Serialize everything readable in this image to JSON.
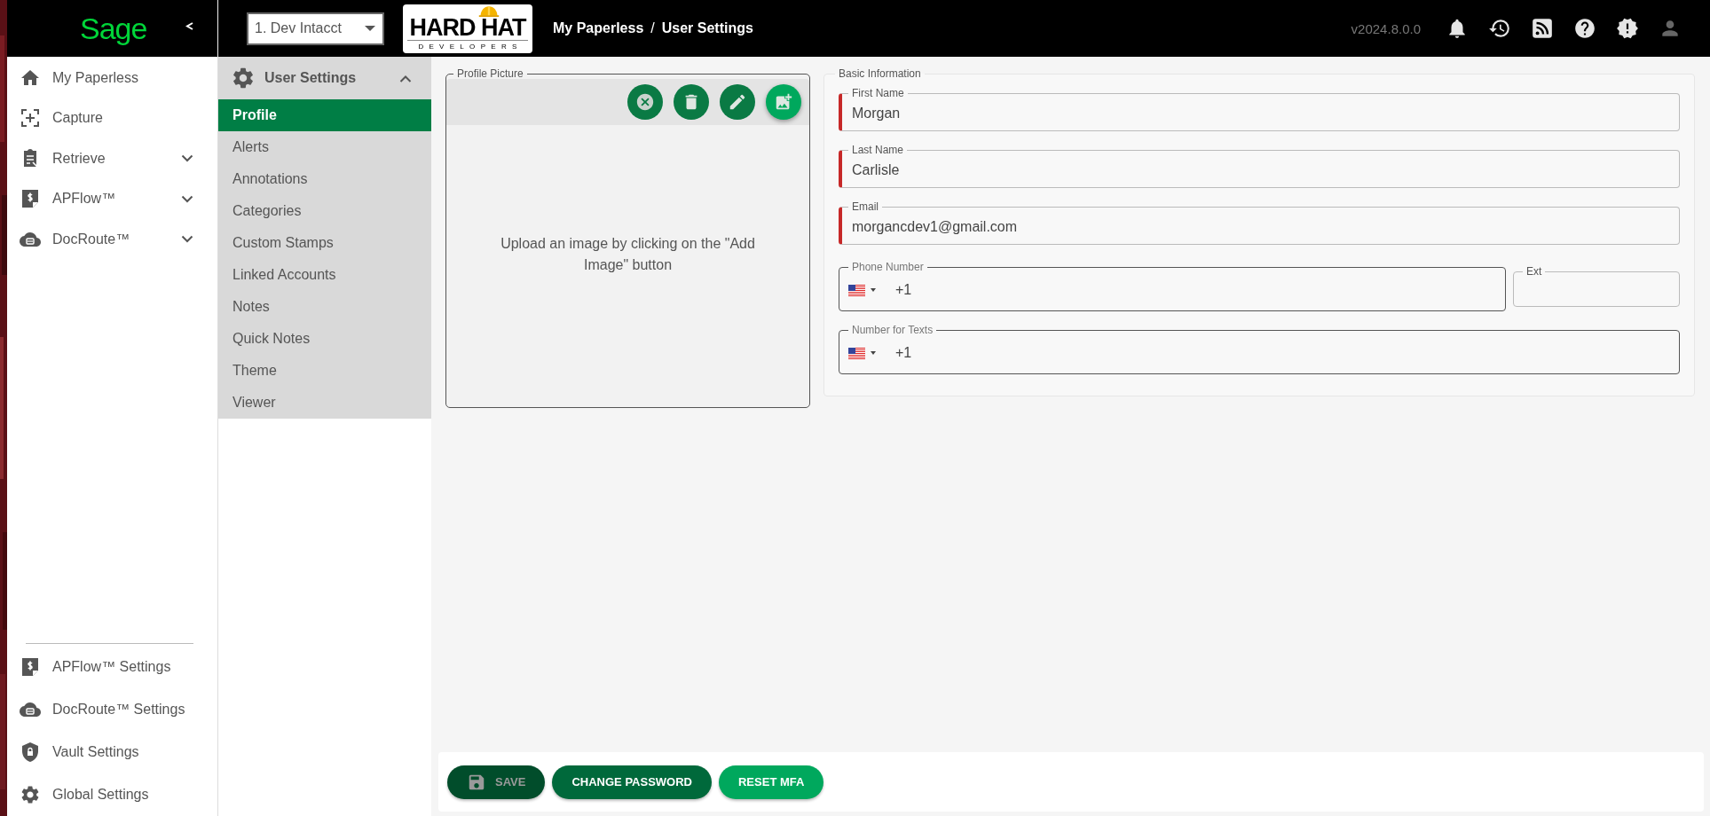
{
  "header": {
    "logo": "Sage",
    "account_select": {
      "value": "1. Dev Intacct"
    },
    "brand_logo": {
      "title": "HARD HAT",
      "subtitle": "DEVELOPERS"
    },
    "breadcrumb": [
      "My Paperless",
      "User Settings"
    ],
    "breadcrumb_separator": "/",
    "version": "v2024.8.0.0"
  },
  "sidebar": {
    "items": [
      {
        "label": "My Paperless",
        "kind": "link"
      },
      {
        "label": "Capture",
        "kind": "link"
      },
      {
        "label": "Retrieve",
        "kind": "group",
        "expanded": false
      },
      {
        "label": "APFlow™",
        "kind": "group",
        "expanded": false
      },
      {
        "label": "DocRoute™",
        "kind": "group",
        "expanded": false
      }
    ],
    "footer_items": [
      {
        "label": "APFlow™ Settings"
      },
      {
        "label": "DocRoute™ Settings"
      },
      {
        "label": "Vault Settings"
      },
      {
        "label": "Global Settings"
      }
    ]
  },
  "settings_menu": {
    "title": "User Settings",
    "expanded": true,
    "items": [
      {
        "label": "Profile",
        "selected": true
      },
      {
        "label": "Alerts",
        "selected": false
      },
      {
        "label": "Annotations",
        "selected": false
      },
      {
        "label": "Categories",
        "selected": false
      },
      {
        "label": "Custom Stamps",
        "selected": false
      },
      {
        "label": "Linked Accounts",
        "selected": false
      },
      {
        "label": "Notes",
        "selected": false
      },
      {
        "label": "Quick Notes",
        "selected": false
      },
      {
        "label": "Theme",
        "selected": false
      },
      {
        "label": "Viewer",
        "selected": false
      }
    ]
  },
  "profile_picture": {
    "legend": "Profile Picture",
    "message": "Upload an image by clicking on the \"Add Image\" button"
  },
  "basic_information": {
    "legend": "Basic Information",
    "fields": [
      {
        "kind": "text",
        "label": "First Name",
        "value": "Morgan",
        "required": true
      },
      {
        "kind": "text",
        "label": "Last Name",
        "value": "Carlisle",
        "required": true
      },
      {
        "kind": "text",
        "label": "Email",
        "value": "morgancdev1@gmail.com",
        "required": true
      },
      {
        "kind": "phone",
        "label": "Phone Number",
        "dial_code": "+1",
        "required": false
      },
      {
        "kind": "text",
        "label": "Ext",
        "required": false
      },
      {
        "kind": "phone",
        "label": "Number for Texts",
        "dial_code": "+1",
        "required": false
      }
    ]
  },
  "actions": [
    {
      "label": "SAVE",
      "disabled": true,
      "color": "#014d2b"
    },
    {
      "label": "CHANGE PASSWORD",
      "disabled": false,
      "color": "#00693b"
    },
    {
      "label": "RESET MFA",
      "disabled": false,
      "color": "#00a85d"
    }
  ]
}
